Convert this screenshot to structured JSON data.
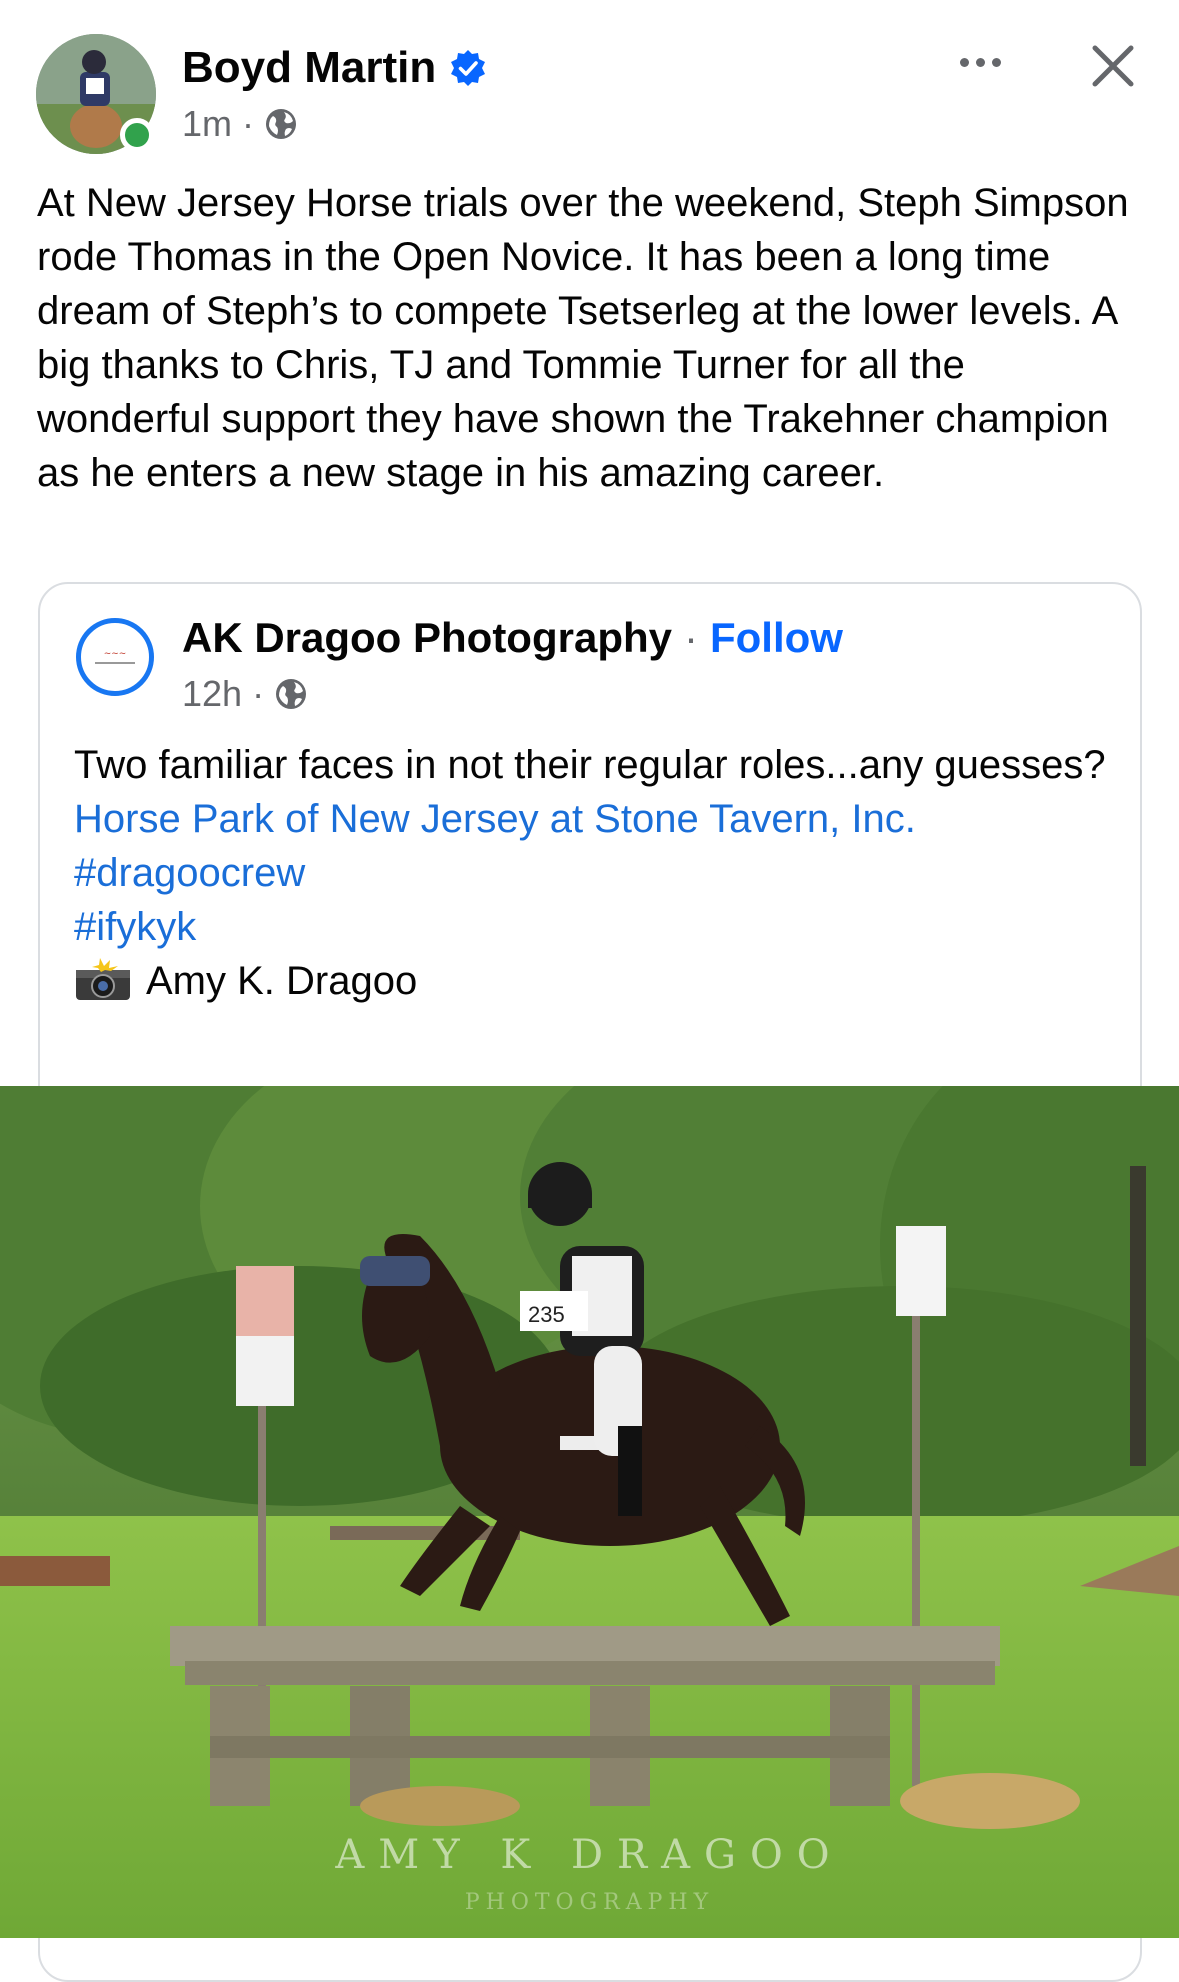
{
  "post": {
    "author": "Boyd Martin",
    "time": "1m",
    "separator": "·",
    "audience_icon": "globe-icon",
    "verified_icon": "verified-badge-icon",
    "text": "At New Jersey Horse trials over the weekend, Steph Simpson rode Thomas in the Open Novice. It has been a long time dream of Steph’s to compete Tsetserleg at the lower levels. A big thanks to Chris, TJ and Tommie Turner for all the wonderful support they have shown the Trakehner champion as he enters a new stage in his amazing career."
  },
  "shared": {
    "author": "AK Dragoo Photography",
    "separator": "·",
    "follow_label": "Follow",
    "time": "12h",
    "text_line1": "Two familiar faces in not their regular roles...any guesses?",
    "link_location": "Horse Park of New Jersey at Stone Tavern, Inc.",
    "hashtag1": "#dragoocrew",
    "hashtag2": "#ifykyk",
    "credit": "Amy K. Dragoo",
    "credit_icon": "camera-flash-icon"
  },
  "photo": {
    "watermark": "AMY K DRAGOO",
    "watermark_sub": "PHOTOGRAPHY",
    "bib_number": "235"
  },
  "colors": {
    "link_blue": "#1a6ed8",
    "follow_blue": "#0866ff",
    "verified_blue": "#0866ff",
    "online_green": "#31a24c"
  }
}
